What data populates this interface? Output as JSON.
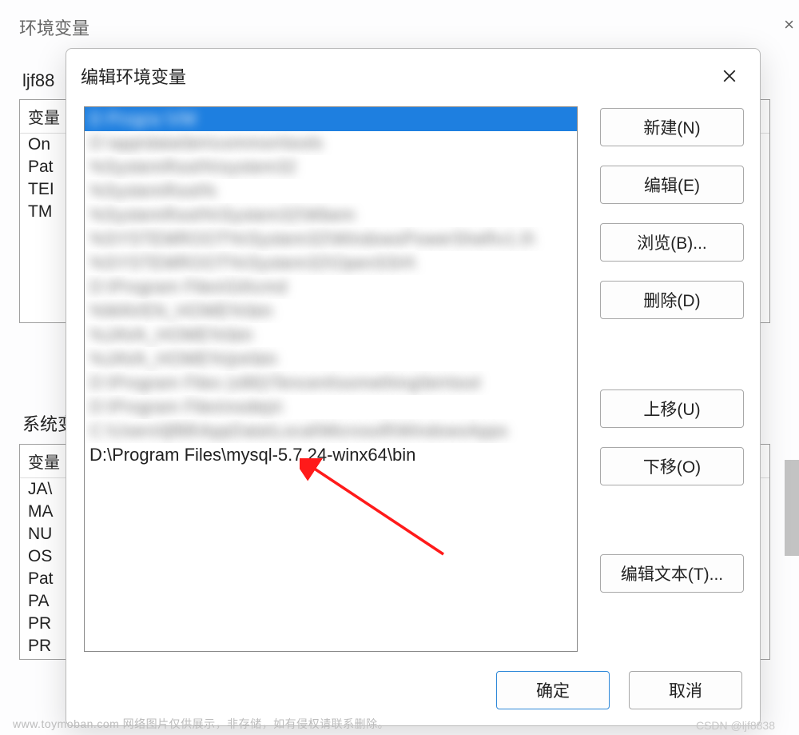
{
  "bg": {
    "title": "环境变量",
    "user_label": "ljf88",
    "user_header": "变量",
    "user_rows": [
      "On",
      "Pat",
      "TEI",
      "TM"
    ],
    "sys_label": "系统变",
    "sys_header": "变量",
    "sys_rows": [
      "JA\\",
      "MA",
      "NU",
      "OS",
      "Pat",
      "PA",
      "PR",
      "PR"
    ]
  },
  "modal": {
    "title": "编辑环境变量",
    "paths": [
      {
        "text": "D  Progra        \\VM                     ",
        "blurred": true,
        "selected": true
      },
      {
        "text": "D:\\app\\data\\bin\\common\\tools",
        "blurred": true
      },
      {
        "text": "%SystemRoot%\\system32",
        "blurred": true
      },
      {
        "text": "%SystemRoot%",
        "blurred": true
      },
      {
        "text": "%SystemRoot%\\System32\\Wbem",
        "blurred": true
      },
      {
        "text": "%SYSTEMROOT%\\System32\\WindowsPowerShell\\v1.0\\",
        "blurred": true
      },
      {
        "text": "%SYSTEMROOT%\\System32\\OpenSSH\\",
        "blurred": true
      },
      {
        "text": "D:\\Program Files\\Git\\cmd",
        "blurred": true
      },
      {
        "text": "%MAVEN_HOME%\\bin",
        "blurred": true
      },
      {
        "text": "%JAVA_HOME%\\bin",
        "blurred": true
      },
      {
        "text": "%JAVA_HOME%\\jre\\bin",
        "blurred": true
      },
      {
        "text": "D:\\Program Files (x86)\\Tencent\\something\\bin\\tool",
        "blurred": true
      },
      {
        "text": "D:\\Program Files\\nodejs\\",
        "blurred": true
      },
      {
        "text": "C:\\Users\\ljf88\\AppData\\Local\\Microsoft\\WindowsApps",
        "blurred": true
      },
      {
        "text": "D:\\Program Files\\mysql-5.7.24-winx64\\bin",
        "blurred": false
      }
    ],
    "buttons": {
      "new": "新建(N)",
      "edit": "编辑(E)",
      "browse": "浏览(B)...",
      "delete": "删除(D)",
      "up": "上移(U)",
      "down": "下移(O)",
      "edit_text": "编辑文本(T)...",
      "ok": "确定",
      "cancel": "取消"
    }
  },
  "watermark": "www.toymoban.com  网络图片仅供展示，非存储，如有侵权请联系删除。",
  "credit": "CSDN @ljf8838"
}
